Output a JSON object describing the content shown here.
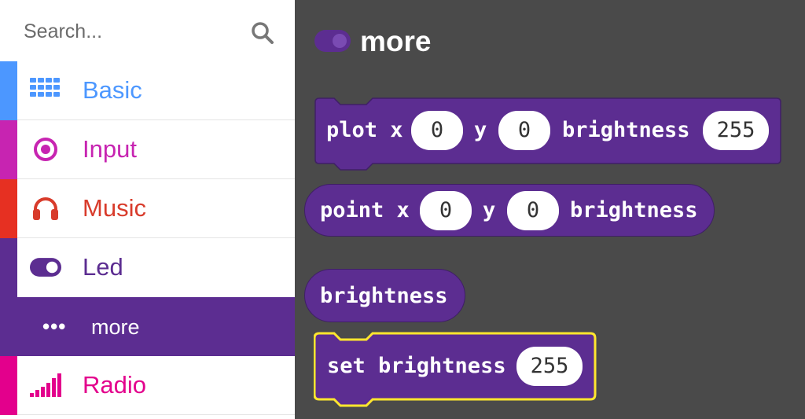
{
  "search": {
    "placeholder": "Search..."
  },
  "categories": [
    {
      "label": "Basic",
      "icon": "grid-icon",
      "color": "#4c97ff"
    },
    {
      "label": "Input",
      "icon": "target-icon",
      "color": "#c724b1"
    },
    {
      "label": "Music",
      "icon": "headphones-icon",
      "color": "#e63022"
    },
    {
      "label": "Led",
      "icon": "toggle-icon",
      "color": "#5c2d91"
    },
    {
      "label": "more",
      "icon": "ellipsis-icon",
      "color": "#5c2d91"
    },
    {
      "label": "Radio",
      "icon": "signal-bars-icon",
      "color": "#e3008c"
    }
  ],
  "workspace": {
    "title": "more",
    "blocks": {
      "plot": {
        "word1": "plot x",
        "x": "0",
        "word2": "y",
        "y": "0",
        "word3": "brightness",
        "brightness": "255"
      },
      "point": {
        "word1": "point x",
        "x": "0",
        "word2": "y",
        "y": "0",
        "word3": "brightness"
      },
      "brightness": {
        "label": "brightness"
      },
      "set_brightness": {
        "label": "set brightness",
        "value": "255"
      }
    }
  },
  "colors": {
    "block": "#5c2d91",
    "block_border": "#3f1f66",
    "selected_outline": "#ffe62e",
    "workspace_bg": "#4a4a4a"
  }
}
